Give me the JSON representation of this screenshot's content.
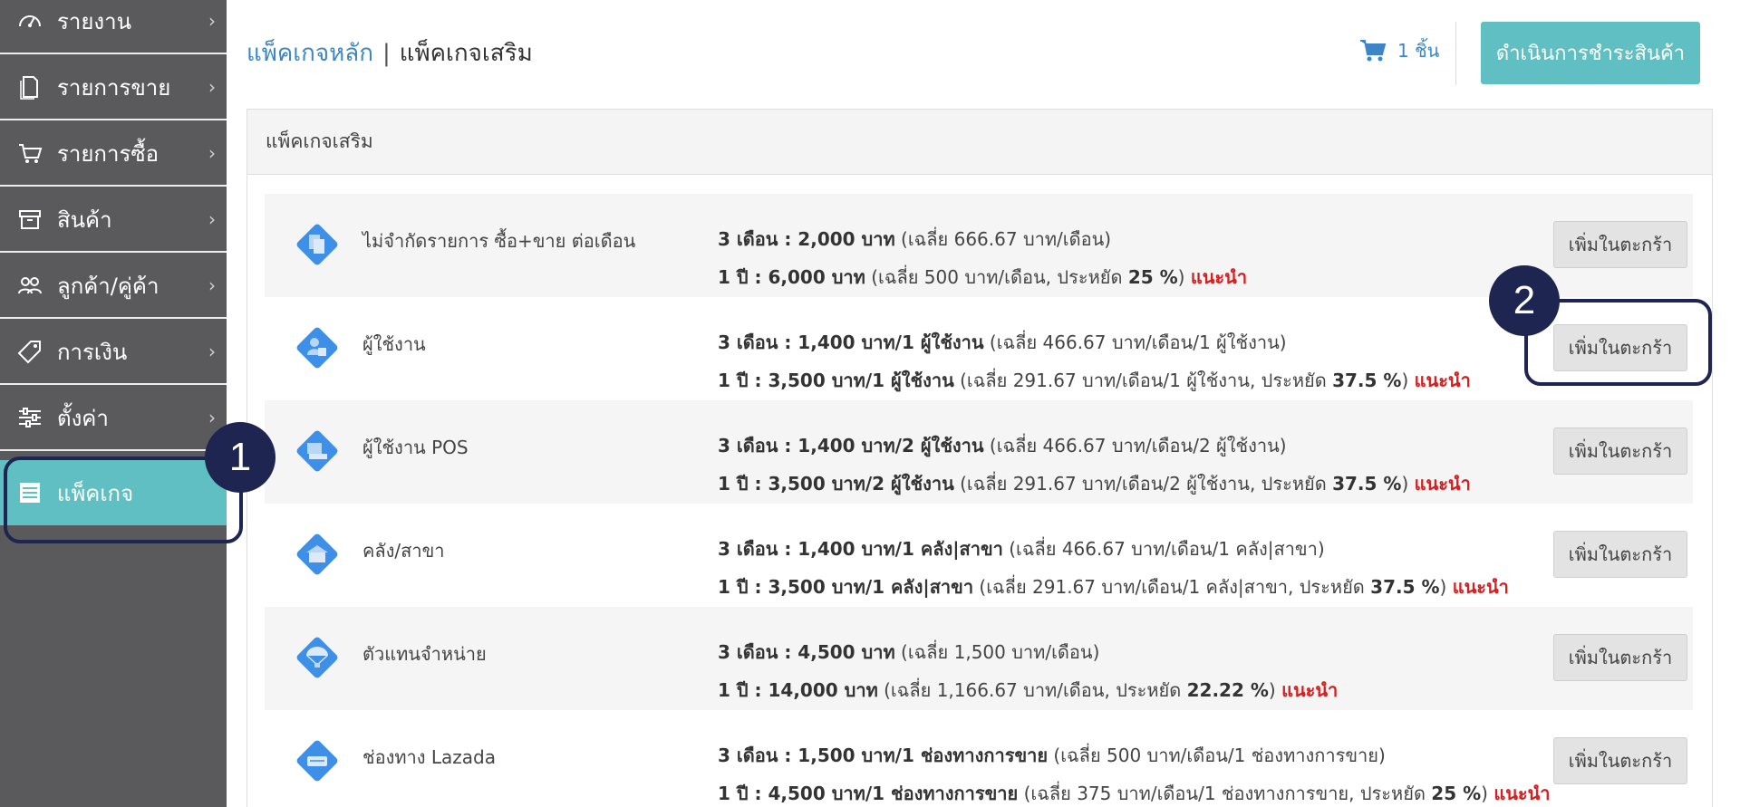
{
  "sidebar": {
    "items": [
      {
        "label": "รายงาน",
        "icon": "dashboard-icon"
      },
      {
        "label": "รายการขาย",
        "icon": "document-icon"
      },
      {
        "label": "รายการซื้อ",
        "icon": "cart-icon"
      },
      {
        "label": "สินค้า",
        "icon": "box-icon"
      },
      {
        "label": "ลูกค้า/คู่ค้า",
        "icon": "users-icon"
      },
      {
        "label": "การเงิน",
        "icon": "tag-icon"
      },
      {
        "label": "ตั้งค่า",
        "icon": "sliders-icon"
      },
      {
        "label": "แพ็คเกจ",
        "icon": "list-icon"
      }
    ],
    "chevron": "›"
  },
  "header": {
    "main_link": "แพ็คเกจหลัก",
    "separator": "|",
    "current": "แพ็คเกจเสริม",
    "cart_count": "1 ชิ้น",
    "checkout_label": "ดำเนินการชำระสินค้า"
  },
  "panel": {
    "title": "แพ็คเกจเสริม",
    "add_label": "เพิ่มในตะกร้า",
    "rows": [
      {
        "name": "ไม่จำกัดรายการ ซื้อ+ขาย ต่อเดือน",
        "l1_bold": "3 เดือน : 2,000 บาท",
        "l1_rest": " (เฉลี่ย 666.67 บาท/เดือน)",
        "l2_bold": "1 ปี : 6,000 บาท",
        "l2_rest": " (เฉลี่ย 500 บาท/เดือน, ประหยัด ",
        "l2_pct": "25 %",
        "l2_close": ")",
        "rec": "แนะนำ",
        "icon": "documents-icon"
      },
      {
        "name": "ผู้ใช้งาน",
        "l1_bold": "3 เดือน : 1,400 บาท/1 ผู้ใช้งาน",
        "l1_rest": " (เฉลี่ย 466.67 บาท/เดือน/1 ผู้ใช้งาน)",
        "l2_bold": "1 ปี : 3,500 บาท/1 ผู้ใช้งาน",
        "l2_rest": " (เฉลี่ย 291.67 บาท/เดือน/1 ผู้ใช้งาน, ประหยัด ",
        "l2_pct": "37.5 %",
        "l2_close": ")",
        "rec": "แนะนำ",
        "icon": "user-icon"
      },
      {
        "name": "ผู้ใช้งาน POS",
        "l1_bold": "3 เดือน : 1,400 บาท/2 ผู้ใช้งาน",
        "l1_rest": " (เฉลี่ย 466.67 บาท/เดือน/2 ผู้ใช้งาน)",
        "l2_bold": "1 ปี : 3,500 บาท/2 ผู้ใช้งาน",
        "l2_rest": " (เฉลี่ย 291.67 บาท/เดือน/2 ผู้ใช้งาน, ประหยัด ",
        "l2_pct": "37.5 %",
        "l2_close": ")",
        "rec": "แนะนำ",
        "icon": "pos-terminal-icon"
      },
      {
        "name": "คลัง/สาขา",
        "l1_bold": "3 เดือน : 1,400 บาท/1 คลัง|สาขา",
        "l1_rest": " (เฉลี่ย 466.67 บาท/เดือน/1 คลัง|สาขา)",
        "l2_bold": "1 ปี : 3,500 บาท/1 คลัง|สาขา",
        "l2_rest": " (เฉลี่ย 291.67 บาท/เดือน/1 คลัง|สาขา, ประหยัด ",
        "l2_pct": "37.5 %",
        "l2_close": ")",
        "rec": "แนะนำ",
        "icon": "warehouse-icon"
      },
      {
        "name": "ตัวแทนจำหน่าย",
        "l1_bold": "3 เดือน : 4,500 บาท",
        "l1_rest": " (เฉลี่ย 1,500 บาท/เดือน)",
        "l2_bold": "1 ปี : 14,000 บาท",
        "l2_rest": " (เฉลี่ย 1,166.67 บาท/เดือน, ประหยัด ",
        "l2_pct": "22.22 %",
        "l2_close": ")",
        "rec": "แนะนำ",
        "icon": "parachute-icon"
      },
      {
        "name": "ช่องทาง Lazada",
        "l1_bold": "3 เดือน : 1,500 บาท/1 ช่องทางการขาย",
        "l1_rest": " (เฉลี่ย 500 บาท/เดือน/1 ช่องทางการขาย)",
        "l2_bold": "1 ปี : 4,500 บาท/1 ช่องทางการขาย",
        "l2_rest": " (เฉลี่ย 375 บาท/เดือน/1 ช่องทางการขาย, ประหยัด ",
        "l2_pct": "25 %",
        "l2_close": ")",
        "rec": "แนะนำ",
        "icon": "lazada-icon"
      }
    ]
  },
  "callouts": [
    "1",
    "2"
  ],
  "colors": {
    "sidebar_bg": "#5a5a5d",
    "accent_teal": "#5fbfc2",
    "link_blue": "#3d86c6",
    "callout_navy": "#1d2550",
    "recommend_red": "#d42020",
    "diamond_blue": "#3d8fe8"
  }
}
